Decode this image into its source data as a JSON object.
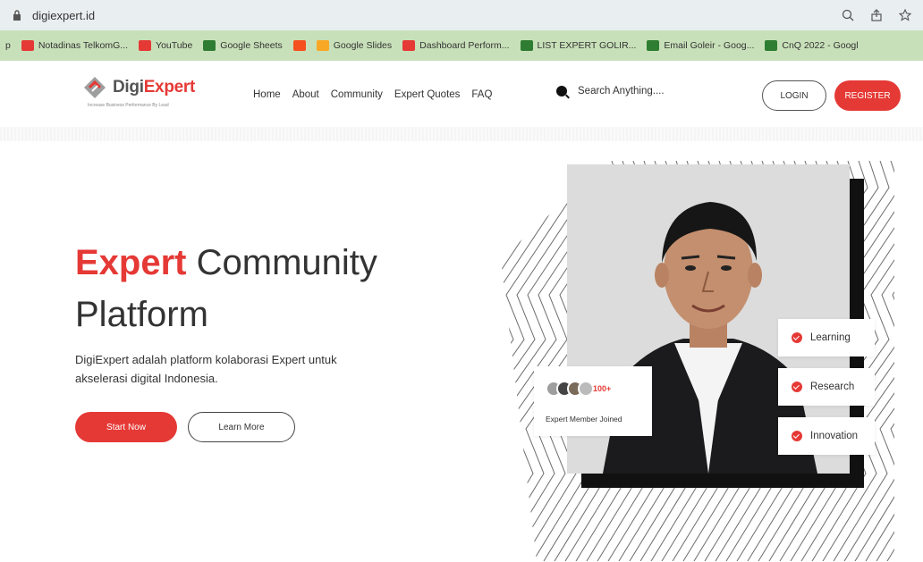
{
  "browser": {
    "url": "digiexpert.id",
    "bookmarks": [
      {
        "label": "Notadinas TelkomG...",
        "color": "#e53935"
      },
      {
        "label": "YouTube",
        "color": "#e53935"
      },
      {
        "label": "Google Sheets",
        "color": "#2e7d32"
      },
      {
        "label": "",
        "color": "#f4511e"
      },
      {
        "label": "Google Slides",
        "color": "#f9a825"
      },
      {
        "label": "Dashboard Perform...",
        "color": "#e53935"
      },
      {
        "label": "LIST EXPERT GOLIR...",
        "color": "#2e7d32"
      },
      {
        "label": "Email Goleir - Goog...",
        "color": "#2e7d32"
      },
      {
        "label": "CnQ 2022 - Googl",
        "color": "#2e7d32"
      }
    ]
  },
  "header": {
    "logo_prefix": "Digi",
    "logo_accent": "Expert",
    "logo_tagline": "Increase Business Performance By Lead",
    "nav": [
      "Home",
      "About",
      "Community",
      "Expert Quotes",
      "FAQ"
    ],
    "search_placeholder": "Search Anything....",
    "login_label": "LOGIN",
    "register_label": "REGISTER"
  },
  "hero": {
    "title_accent": "Expert",
    "title_rest": " Community",
    "title_line2": "Platform",
    "description": "DigiExpert adalah platform kolaborasi Expert untuk akselerasi digital Indonesia.",
    "start_label": "Start Now",
    "learn_label": "Learn More"
  },
  "members": {
    "count": "100+",
    "label": "Expert Member Joined"
  },
  "tags": [
    "Learning",
    "Research",
    "Innovation"
  ],
  "colors": {
    "accent": "#e53935",
    "bookmark_bar": "#c8e0b9",
    "address_bar": "#e9eef0"
  }
}
